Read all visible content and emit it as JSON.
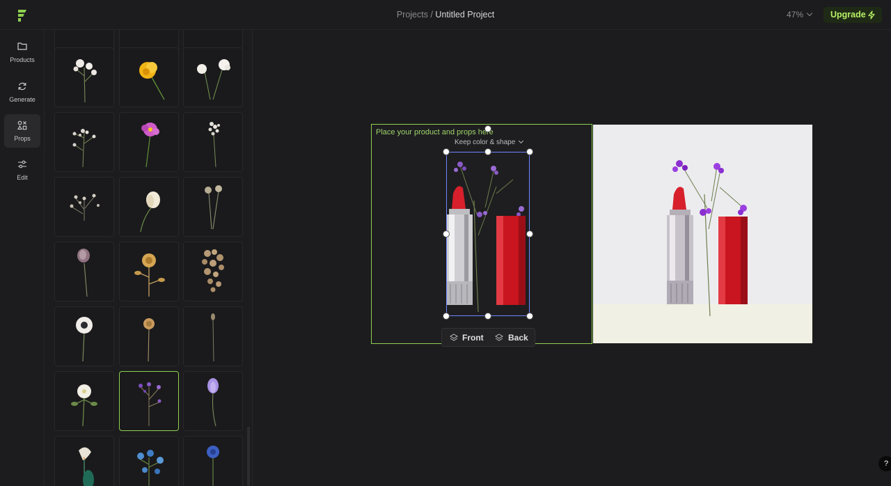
{
  "header": {
    "breadcrumb_root": "Projects",
    "breadcrumb_separator": "/",
    "project_name": "Untitled Project",
    "zoom": "47%",
    "upgrade_label": "Upgrade"
  },
  "nav": {
    "items": [
      {
        "label": "Products",
        "icon": "folder-icon"
      },
      {
        "label": "Generate",
        "icon": "refresh-icon"
      },
      {
        "label": "Props",
        "icon": "props-icon",
        "active": true
      },
      {
        "label": "Edit",
        "icon": "sliders-icon"
      }
    ]
  },
  "canvas": {
    "hint": "Place your product and props here",
    "mode_select": "Keep color & shape",
    "front_label": "Front",
    "back_label": "Back"
  },
  "help_label": "?",
  "colors": {
    "accent": "#8fd14f",
    "upgrade_text": "#b6ef65",
    "selection": "#6f86ff"
  }
}
